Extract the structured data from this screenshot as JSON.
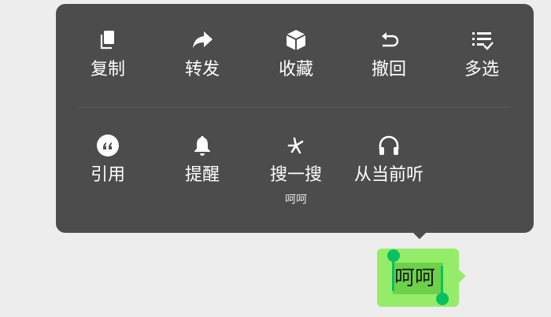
{
  "menu": {
    "row1": [
      {
        "id": "copy",
        "label": "复制",
        "icon": "copy-icon"
      },
      {
        "id": "forward",
        "label": "转发",
        "icon": "forward-icon"
      },
      {
        "id": "favorite",
        "label": "收藏",
        "icon": "cube-icon"
      },
      {
        "id": "recall",
        "label": "撤回",
        "icon": "undo-icon"
      },
      {
        "id": "multiselect",
        "label": "多选",
        "icon": "list-check-icon"
      }
    ],
    "row2": [
      {
        "id": "quote",
        "label": "引用",
        "icon": "quote-icon"
      },
      {
        "id": "remind",
        "label": "提醒",
        "icon": "bell-icon"
      },
      {
        "id": "search",
        "label": "搜一搜",
        "icon": "sparkle-icon",
        "sub": "呵呵"
      },
      {
        "id": "listen",
        "label": "从当前听",
        "icon": "headphones-icon"
      }
    ]
  },
  "message": {
    "text": "呵呵"
  },
  "colors": {
    "menu_bg": "#4c4c4c",
    "bubble_bg": "#95ec69",
    "selection": "#6dd14a",
    "handle": "#07c160",
    "screen_bg": "#ededed"
  }
}
